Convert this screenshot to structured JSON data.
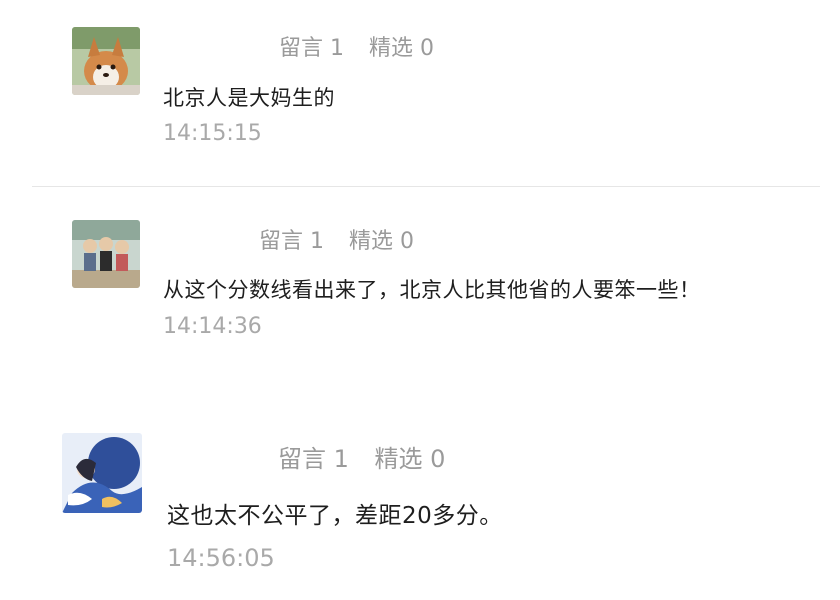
{
  "comments": [
    {
      "avatar_icon": "corgi-dog-avatar-icon",
      "reply_label": "留言 1",
      "featured_label": "精选 0",
      "text": "北京人是大妈生的",
      "time": "14:15:15"
    },
    {
      "avatar_icon": "group-of-people-avatar-icon",
      "reply_label": "留言 1",
      "featured_label": "精选 0",
      "text": "从这个分数线看出来了，北京人比其他省的人要笨一些！",
      "time": "14:14:36"
    },
    {
      "avatar_icon": "anime-girl-avatar-icon",
      "reply_label": "留言 1",
      "featured_label": "精选 0",
      "text": "这也太不公平了，差距20多分。",
      "time": "14:56:05"
    }
  ]
}
